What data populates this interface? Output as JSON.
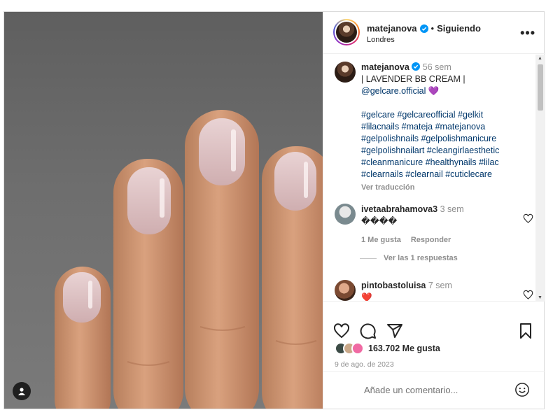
{
  "post": {
    "username": "matejanova",
    "separator": "•",
    "follow_status": "Siguiendo",
    "location": "Londres",
    "more_label": "•••"
  },
  "caption": {
    "username": "matejanova",
    "time": "56 sem",
    "title": "| LAVENDER BB CREAM |",
    "mention": "@gelcare.official",
    "heart_emoji": "💜",
    "hashtags": "#gelcare #gelcareofficial #gelkit #lilacnails #mateja #matejanova #gelpolishnails #gelpolishmanicure #gelpolishnailart #cleangirlaesthetic #cleanmanicure #healthynails #lilac #clearnails #clearnail #cuticlecare",
    "translate_label": "Ver traducción"
  },
  "comments": [
    {
      "username": "ivetaabrahamova3",
      "time": "3 sem",
      "text": "����",
      "likes_label": "1 Me gusta",
      "reply_label": "Responder",
      "view_replies_label": "Ver las 1 respuestas"
    },
    {
      "username": "pintobastoluisa",
      "time": "7 sem",
      "text": "❤️"
    }
  ],
  "stats": {
    "likes": "163.702 Me gusta",
    "date": "9 de ago. de 2023"
  },
  "add_comment": {
    "placeholder": "Añade un comentario..."
  },
  "colors": {
    "link": "#00376b",
    "verified": "#0095f6",
    "heart_red": "#ed4956"
  }
}
